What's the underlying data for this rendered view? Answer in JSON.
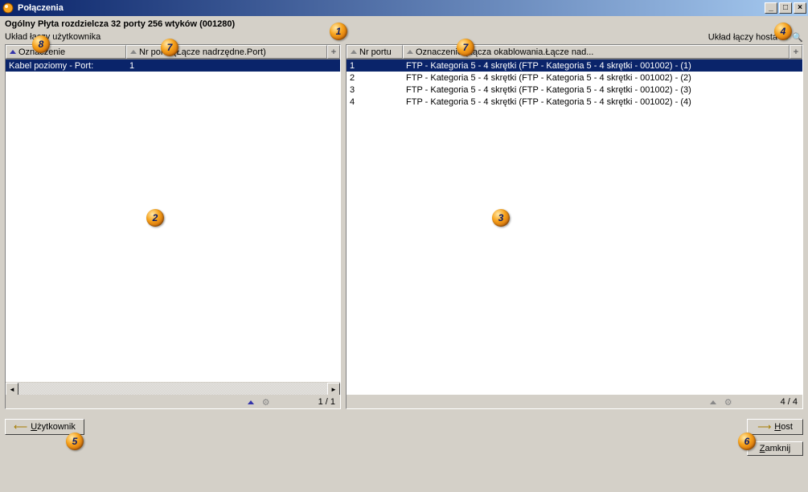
{
  "window": {
    "title": "Połączenia"
  },
  "subtitle": "Ogólny Płyta rozdzielcza 32 porty 256 wtyków (001280)",
  "labels": {
    "user_link_layout": "Układ łączy użytkownika",
    "host_link_layout": "Układ łączy hosta"
  },
  "left": {
    "columns": {
      "designation": "Oznaczenie",
      "port_no": "Nr portu (Łącze nadrzędne.Port)"
    },
    "rows": [
      {
        "designation": "Kabel poziomy  - Port:",
        "port": "1"
      }
    ],
    "page": "1 / 1"
  },
  "right": {
    "columns": {
      "port_no": "Nr portu",
      "designation": "Oznaczenie (Łącza okablowania.Łącze nad..."
    },
    "rows": [
      {
        "port": "1",
        "desc": "FTP - Kategoria 5 - 4 skrętki (FTP - Kategoria 5 - 4 skrętki - 001002) - (1)"
      },
      {
        "port": "2",
        "desc": "FTP - Kategoria 5 - 4 skrętki (FTP - Kategoria 5 - 4 skrętki - 001002) - (2)"
      },
      {
        "port": "3",
        "desc": "FTP - Kategoria 5 - 4 skrętki (FTP - Kategoria 5 - 4 skrętki - 001002) - (3)"
      },
      {
        "port": "4",
        "desc": "FTP - Kategoria 5 - 4 skrętki (FTP - Kategoria 5 - 4 skrętki - 001002) - (4)"
      }
    ],
    "page": "4 / 4"
  },
  "buttons": {
    "user": "Użytkownik",
    "host": "Host",
    "close": "Zamknij"
  },
  "markers": {
    "1": "1",
    "2": "2",
    "3": "3",
    "4": "4",
    "5": "5",
    "6": "6",
    "7_left": "7",
    "7_right": "7",
    "8": "8"
  }
}
